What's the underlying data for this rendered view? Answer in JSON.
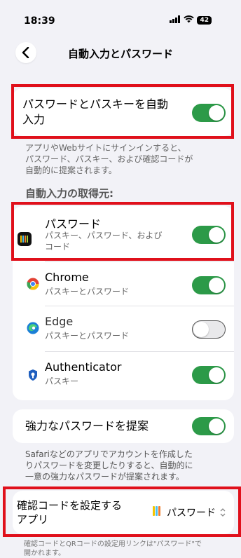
{
  "status": {
    "time": "18:39",
    "battery": "42"
  },
  "nav": {
    "title": "自動入力とパスワード"
  },
  "autofill": {
    "label_line1": "パスワードとパスキーを自動",
    "label_line2": "入力",
    "description": [
      "アプリやWebサイトにサインインすると、",
      "パスワード、パスキー、および確認コードが",
      "自動的に提案されます。"
    ],
    "enabled": true
  },
  "section_title": "自動入力の取得元:",
  "sources": [
    {
      "name": "パスワード",
      "sub_line1": "パスキー、パスワード、および",
      "sub_line2": "コード",
      "enabled": true,
      "icon": "passwords-app-icon"
    },
    {
      "name": "Chrome",
      "sub_line1": "パスキーとパスワード",
      "enabled": true,
      "icon": "chrome-icon"
    },
    {
      "name": "Edge",
      "sub_line1": "パスキーとパスワード",
      "enabled": false,
      "icon": "edge-icon"
    },
    {
      "name": "Authenticator",
      "sub_line1": "パスキー",
      "enabled": true,
      "icon": "authenticator-icon"
    }
  ],
  "strong_password": {
    "label": "強力なパスワードを提案",
    "enabled": true,
    "description": [
      "Safariなどのアプリでアカウントを作成した",
      "りパスワードを変更したりすると、自動的に",
      "一意の強力なパスワードが提案されます。"
    ]
  },
  "verification": {
    "label_line1": "確認コードを設定する",
    "label_line2": "アプリ",
    "value": "パスワード",
    "footer_line1": "確認コードとQRコードの設定用リンクは\"パスワード\"で",
    "footer_line2": "開かれます。"
  },
  "colors": {
    "toggle_on": "#2c9a48",
    "highlight": "#e0101b"
  }
}
